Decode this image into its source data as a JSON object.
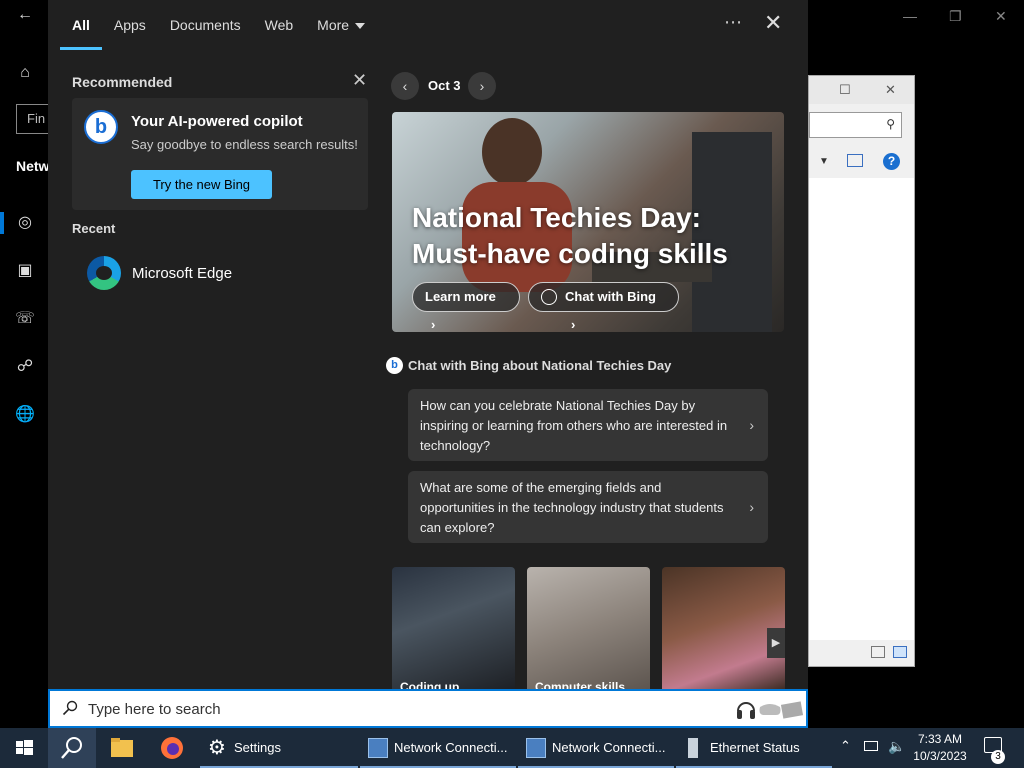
{
  "background": {
    "settings": {
      "find_placeholder": "Fin",
      "section_title": "Netw"
    }
  },
  "tabs": [
    {
      "label": "All"
    },
    {
      "label": "Apps"
    },
    {
      "label": "Documents"
    },
    {
      "label": "Web"
    },
    {
      "label": "More"
    }
  ],
  "flyout": {
    "menu_label": "⋯",
    "close_label": "✕"
  },
  "recommended": {
    "header": "Recommended",
    "close_label": "✕",
    "card": {
      "logo": "b",
      "title": "Your AI-powered copilot",
      "subtitle": "Say goodbye to endless search results!",
      "button": "Try the new Bing"
    }
  },
  "recent": {
    "header": "Recent",
    "items": [
      {
        "label": "Microsoft Edge",
        "icon": "edge-icon"
      }
    ]
  },
  "highlights": {
    "date": "Oct 3",
    "prev_label": "‹",
    "next_label": "›",
    "hero": {
      "title": "National Techies Day: Must-have coding skills",
      "learn_more": "Learn more",
      "chat_with_bing": "Chat with Bing"
    },
    "chat_about": {
      "logo": "b",
      "title": "Chat with Bing about National Techies Day"
    },
    "suggestions": [
      {
        "text": "How can you celebrate National Techies Day by inspiring or learning from others who are interested in technology?"
      },
      {
        "text": "What are some of the emerging fields and opportunities in the technology industry that students can explore?"
      }
    ],
    "thumbnails": [
      {
        "label": "Coding up"
      },
      {
        "label": "Computer skills"
      },
      {
        "label": ""
      }
    ]
  },
  "search": {
    "placeholder": "Type here to search"
  },
  "taskbar": {
    "apps": [
      {
        "label": "Settings"
      },
      {
        "label": "Network Connecti..."
      },
      {
        "label": "Network Connecti..."
      },
      {
        "label": "Ethernet Status"
      }
    ],
    "clock": {
      "time": "7:33 AM",
      "date": "10/3/2023"
    },
    "notification_count": "3"
  },
  "colors": {
    "accent": "#4cc2ff",
    "flyout_bg": "#202020",
    "taskbar_bg": "#1c2a3a",
    "search_border": "#0078d7"
  }
}
